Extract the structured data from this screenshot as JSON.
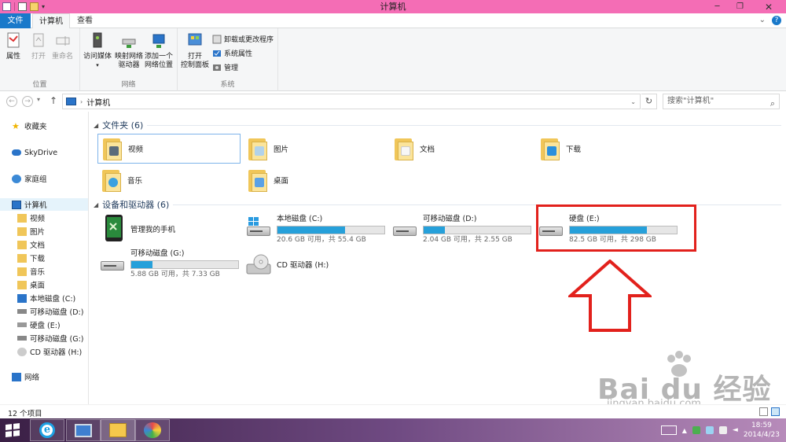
{
  "window": {
    "title": "计算机",
    "minimize": "─",
    "maximize": "❐",
    "close": "✕"
  },
  "ribbon": {
    "tabs": [
      "文件",
      "计算机",
      "查看"
    ],
    "groups": [
      {
        "label": "位置",
        "buttons": [
          "属性",
          "打开",
          "重命名"
        ]
      },
      {
        "label": "网络",
        "buttons": [
          "访问媒体",
          "映射网络\n驱动器",
          "添加一个\n网络位置"
        ]
      },
      {
        "label": "系统",
        "buttons": [
          "打开\n控制面板"
        ],
        "small_buttons": [
          "卸载或更改程序",
          "系统属性",
          "管理"
        ]
      }
    ]
  },
  "address": {
    "back": "←",
    "forward": "→",
    "path": "计算机",
    "refresh": "↻",
    "search_placeholder": "搜索\"计算机\"",
    "search_icon": "search-icon"
  },
  "sidebar": {
    "favorites": "收藏夹",
    "skydrive": "SkyDrive",
    "homegroup": "家庭组",
    "computer": "计算机",
    "children": [
      "视频",
      "图片",
      "文档",
      "下载",
      "音乐",
      "桌面",
      "本地磁盘 (C:)",
      "可移动磁盘 (D:)",
      "硬盘 (E:)",
      "可移动磁盘 (G:)",
      "CD 驱动器 (H:)"
    ],
    "network": "网络"
  },
  "folders_section": {
    "header": "文件夹 (6)",
    "items": [
      "视频",
      "图片",
      "文档",
      "下载",
      "音乐",
      "桌面"
    ]
  },
  "devices_section": {
    "header": "设备和驱动器 (6)",
    "items": [
      {
        "name": "管理我的手机",
        "type": "phone"
      },
      {
        "name": "本地磁盘 (C:)",
        "free": "20.6 GB 可用，共 55.4 GB",
        "used_fraction": 0.63
      },
      {
        "name": "可移动磁盘 (D:)",
        "free": "2.04 GB 可用，共 2.55 GB",
        "used_fraction": 0.2
      },
      {
        "name": "硬盘 (E:)",
        "free": "82.5 GB 可用，共 298 GB",
        "used_fraction": 0.72
      },
      {
        "name": "可移动磁盘 (G:)",
        "free": "5.88 GB 可用，共 7.33 GB",
        "used_fraction": 0.2
      },
      {
        "name": "CD 驱动器 (H:)",
        "type": "cd"
      }
    ]
  },
  "status": {
    "item_count": "12 个项目"
  },
  "taskbar": {
    "time": "18:59",
    "date": "2014/4/23"
  },
  "watermark": {
    "main": "Bai du 经验",
    "sub": "jingyan.baidu.com"
  },
  "colors": {
    "titlebar": "#f46db5",
    "accent": "#1979ca",
    "bar_fill": "#26a0da",
    "highlight": "#e2211c"
  }
}
